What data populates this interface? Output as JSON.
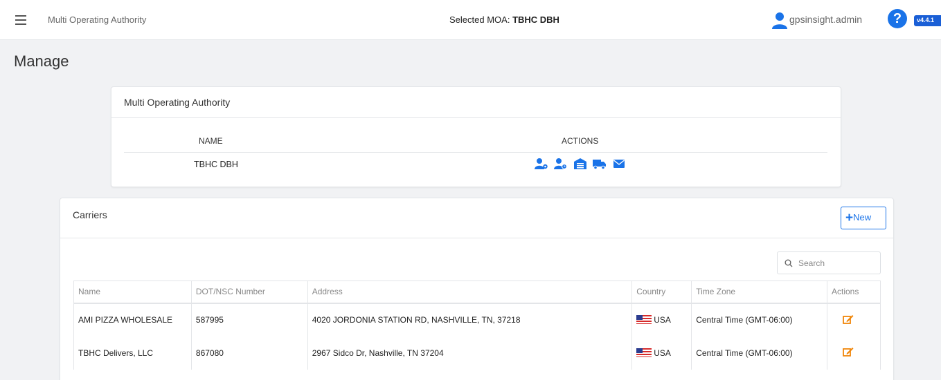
{
  "topbar": {
    "app_title": "Multi Operating Authority",
    "selected_prefix": "Selected MOA:",
    "selected_value": "TBHC DBH",
    "username": "gpsinsight.admin",
    "help_label": "?",
    "version": "v4.4.1"
  },
  "page": {
    "title": "Manage"
  },
  "moa_card": {
    "title": "Multi Operating Authority",
    "col_name": "NAME",
    "col_actions": "ACTIONS",
    "row_name": "TBHC DBH",
    "action_icons": [
      "user-settings-icon",
      "user-clock-icon",
      "warehouse-icon",
      "truck-icon",
      "envelope-icon"
    ]
  },
  "carriers": {
    "title": "Carriers",
    "new_label": "New",
    "search_placeholder": "Search",
    "columns": [
      "Name",
      "DOT/NSC Number",
      "Address",
      "Country",
      "Time Zone",
      "Actions"
    ],
    "rows": [
      {
        "name": "AMI PIZZA WHOLESALE",
        "dot": "587995",
        "address": "4020 JORDONIA STATION RD, NASHVILLE, TN, 37218",
        "country": "USA",
        "timezone": "Central Time (GMT-06:00)"
      },
      {
        "name": "TBHC Delivers, LLC",
        "dot": "867080",
        "address": "2967 Sidco Dr, Nashville, TN 37204",
        "country": "USA",
        "timezone": "Central Time (GMT-06:00)"
      }
    ]
  },
  "colors": {
    "accent": "#1a73e8",
    "edit_icon": "#f0860a",
    "version_badge": "#1a5fd6"
  }
}
